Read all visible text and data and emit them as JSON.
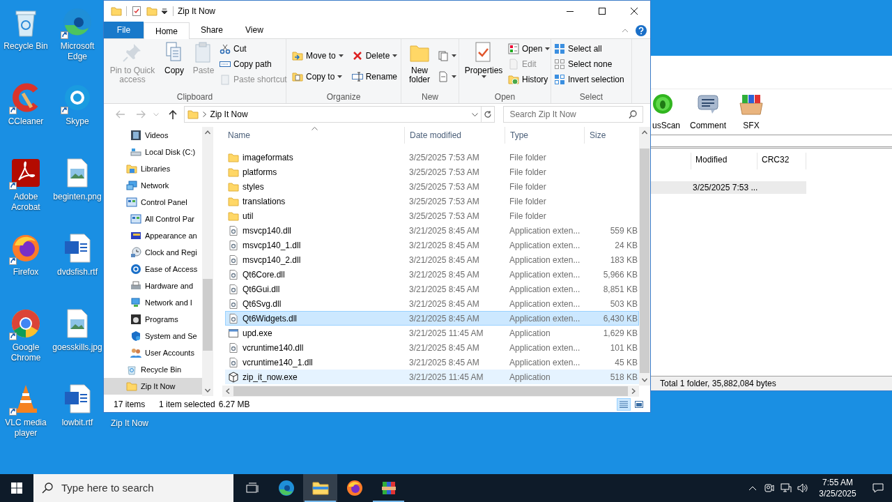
{
  "desktop": {
    "icons": [
      {
        "label": "Recycle Bin",
        "shortcut": false
      },
      {
        "label": "Microsoft Edge",
        "shortcut": true
      },
      {
        "label": "CCleaner",
        "shortcut": true
      },
      {
        "label": "Skype",
        "shortcut": true
      },
      {
        "label": "Adobe Acrobat",
        "shortcut": true
      },
      {
        "label": "beginten.png",
        "shortcut": false
      },
      {
        "label": "Firefox",
        "shortcut": true
      },
      {
        "label": "dvdsfish.rtf",
        "shortcut": false
      },
      {
        "label": "Google Chrome",
        "shortcut": true
      },
      {
        "label": "goesskills.jpg",
        "shortcut": false
      },
      {
        "label": "VLC media player",
        "shortcut": true
      },
      {
        "label": "lowbit.rtf",
        "shortcut": false
      }
    ],
    "covered_icon": {
      "label": "Zip It Now"
    }
  },
  "explorer": {
    "title": "Zip It Now",
    "tabs": [
      {
        "label": "File",
        "kind": "file",
        "selected": false
      },
      {
        "label": "Home",
        "kind": "tab",
        "selected": true
      },
      {
        "label": "Share",
        "kind": "tab",
        "selected": false
      },
      {
        "label": "View",
        "kind": "tab",
        "selected": false
      }
    ],
    "groups": [
      {
        "label": "Clipboard",
        "columns": [
          {
            "kind": "large",
            "items": [
              {
                "label": "Pin to Quick access",
                "disabled": true,
                "dropdown": false
              }
            ]
          },
          {
            "kind": "large",
            "items": [
              {
                "label": "Copy",
                "disabled": false,
                "dropdown": false
              }
            ]
          },
          {
            "kind": "large",
            "items": [
              {
                "label": "Paste",
                "disabled": true,
                "dropdown": false
              }
            ]
          },
          {
            "kind": "small",
            "items": [
              {
                "label": "Cut",
                "disabled": false,
                "dropdown": false
              },
              {
                "label": "Copy path",
                "disabled": false,
                "dropdown": false
              },
              {
                "label": "Paste shortcut",
                "disabled": true,
                "dropdown": false
              }
            ]
          }
        ]
      },
      {
        "label": "Organize",
        "columns": [
          {
            "kind": "small",
            "items": [
              {
                "label": "Move to",
                "disabled": false,
                "dropdown": true
              },
              {
                "label": "Copy to",
                "disabled": false,
                "dropdown": true
              }
            ]
          },
          {
            "kind": "small",
            "items": [
              {
                "label": "Delete",
                "disabled": false,
                "dropdown": true
              },
              {
                "label": "Rename",
                "disabled": false,
                "dropdown": false
              }
            ]
          }
        ]
      },
      {
        "label": "New",
        "columns": [
          {
            "kind": "large",
            "items": [
              {
                "label": "New folder",
                "disabled": false,
                "dropdown": false
              }
            ]
          },
          {
            "kind": "small",
            "items": [
              {
                "disabled": false,
                "dropdown": true
              },
              {
                "disabled": false,
                "dropdown": true
              }
            ]
          }
        ]
      },
      {
        "label": "Open",
        "columns": [
          {
            "kind": "large",
            "items": [
              {
                "label": "Properties",
                "disabled": false,
                "dropdown": true
              }
            ]
          },
          {
            "kind": "small",
            "items": [
              {
                "label": "Open",
                "disabled": false,
                "dropdown": true
              },
              {
                "label": "Edit",
                "disabled": true,
                "dropdown": false
              },
              {
                "label": "History",
                "disabled": false,
                "dropdown": false
              }
            ]
          }
        ]
      },
      {
        "label": "Select",
        "columns": [
          {
            "kind": "small",
            "items": [
              {
                "label": "Select all",
                "disabled": false,
                "dropdown": false
              },
              {
                "label": "Select none",
                "disabled": false,
                "dropdown": false
              },
              {
                "label": "Invert selection",
                "disabled": false,
                "dropdown": false
              }
            ]
          }
        ]
      }
    ],
    "address": {
      "path": "Zip It Now"
    },
    "search": {
      "placeholder": "Search Zip It Now"
    },
    "nav_pane": {
      "continued_children": [
        {
          "label": "Videos",
          "selected": false
        },
        {
          "label": "Local Disk (C:)",
          "selected": false
        }
      ],
      "items": [
        {
          "label": "Libraries",
          "selected": false
        },
        {
          "label": "Network",
          "selected": false
        },
        {
          "label": "Control Panel",
          "selected": false,
          "children": [
            {
              "label": "All Control Par",
              "selected": false
            },
            {
              "label": "Appearance an",
              "selected": false
            },
            {
              "label": "Clock and Regi",
              "selected": false
            },
            {
              "label": "Ease of Access",
              "selected": false
            },
            {
              "label": "Hardware and",
              "selected": false
            },
            {
              "label": "Network and I",
              "selected": false
            },
            {
              "label": "Programs",
              "selected": false
            },
            {
              "label": "System and Se",
              "selected": false
            },
            {
              "label": "User Accounts",
              "selected": false
            }
          ]
        },
        {
          "label": "Recycle Bin",
          "selected": false
        },
        {
          "label": "Zip It Now",
          "selected": true
        }
      ]
    },
    "columns": [
      "Name",
      "Date modified",
      "Type",
      "Size"
    ],
    "rows": [
      {
        "kind": "folder",
        "name": "imageformats",
        "date": "3/25/2025 7:53 AM",
        "type": "File folder",
        "size": "",
        "selected": false,
        "hovered": false
      },
      {
        "kind": "folder",
        "name": "platforms",
        "date": "3/25/2025 7:53 AM",
        "type": "File folder",
        "size": "",
        "selected": false,
        "hovered": false
      },
      {
        "kind": "folder",
        "name": "styles",
        "date": "3/25/2025 7:53 AM",
        "type": "File folder",
        "size": "",
        "selected": false,
        "hovered": false
      },
      {
        "kind": "folder",
        "name": "translations",
        "date": "3/25/2025 7:53 AM",
        "type": "File folder",
        "size": "",
        "selected": false,
        "hovered": false
      },
      {
        "kind": "folder",
        "name": "util",
        "date": "3/25/2025 7:53 AM",
        "type": "File folder",
        "size": "",
        "selected": false,
        "hovered": false
      },
      {
        "kind": "dll",
        "name": "msvcp140.dll",
        "date": "3/21/2025 8:45 AM",
        "type": "Application exten...",
        "size": "559 KB",
        "selected": false,
        "hovered": false
      },
      {
        "kind": "dll",
        "name": "msvcp140_1.dll",
        "date": "3/21/2025 8:45 AM",
        "type": "Application exten...",
        "size": "24 KB",
        "selected": false,
        "hovered": false
      },
      {
        "kind": "dll",
        "name": "msvcp140_2.dll",
        "date": "3/21/2025 8:45 AM",
        "type": "Application exten...",
        "size": "183 KB",
        "selected": false,
        "hovered": false
      },
      {
        "kind": "dll",
        "name": "Qt6Core.dll",
        "date": "3/21/2025 8:45 AM",
        "type": "Application exten...",
        "size": "5,966 KB",
        "selected": false,
        "hovered": false
      },
      {
        "kind": "dll",
        "name": "Qt6Gui.dll",
        "date": "3/21/2025 8:45 AM",
        "type": "Application exten...",
        "size": "8,851 KB",
        "selected": false,
        "hovered": false
      },
      {
        "kind": "dll",
        "name": "Qt6Svg.dll",
        "date": "3/21/2025 8:45 AM",
        "type": "Application exten...",
        "size": "503 KB",
        "selected": false,
        "hovered": false
      },
      {
        "kind": "dll",
        "name": "Qt6Widgets.dll",
        "date": "3/21/2025 8:45 AM",
        "type": "Application exten...",
        "size": "6,430 KB",
        "selected": true,
        "hovered": false
      },
      {
        "kind": "exe",
        "name": "upd.exe",
        "date": "3/21/2025 11:45 AM",
        "type": "Application",
        "size": "1,629 KB",
        "selected": false,
        "hovered": false
      },
      {
        "kind": "dll",
        "name": "vcruntime140.dll",
        "date": "3/21/2025 8:45 AM",
        "type": "Application exten...",
        "size": "101 KB",
        "selected": false,
        "hovered": false
      },
      {
        "kind": "dll",
        "name": "vcruntime140_1.dll",
        "date": "3/21/2025 8:45 AM",
        "type": "Application exten...",
        "size": "45 KB",
        "selected": false,
        "hovered": false
      },
      {
        "kind": "package",
        "name": "zip_it_now.exe",
        "date": "3/21/2025 11:45 AM",
        "type": "Application",
        "size": "518 KB",
        "selected": false,
        "hovered": true
      }
    ],
    "status": {
      "count": "17 items",
      "selection": "1 item selected",
      "size": "6.27 MB"
    }
  },
  "archiver": {
    "tools": [
      "usScan",
      "Comment",
      "SFX"
    ],
    "columns": [
      "Modified",
      "CRC32"
    ],
    "rows": [
      {
        "modified": "3/25/2025 7:53 ...",
        "selected": true
      }
    ],
    "status": "Total 1 folder, 35,882,084 bytes"
  },
  "taskbar": {
    "search_placeholder": "Type here to search",
    "apps": [
      {
        "running": false,
        "active": false
      },
      {
        "running": false,
        "active": false
      },
      {
        "running": true,
        "active": true
      },
      {
        "running": false,
        "active": false
      },
      {
        "running": true,
        "active": false
      }
    ],
    "time": "7:55 AM",
    "date": "3/25/2025"
  }
}
